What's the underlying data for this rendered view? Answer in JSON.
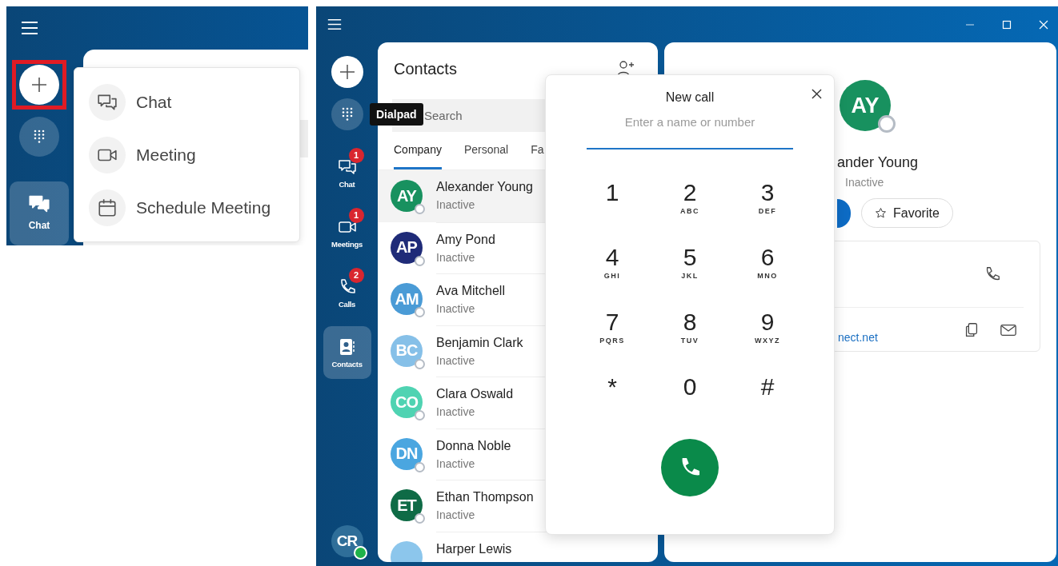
{
  "left_shot": {
    "plus_button": {
      "highlighted": true
    },
    "nav_items": [
      {
        "kind": "chat",
        "label": "Chat",
        "selected": true
      }
    ],
    "new_menu": [
      {
        "kind": "chat",
        "label": "Chat"
      },
      {
        "kind": "meeting",
        "label": "Meeting"
      },
      {
        "kind": "schedule",
        "label": "Schedule Meeting"
      }
    ]
  },
  "right_shot": {
    "rail": {
      "tooltip": "Dialpad",
      "nav_items": [
        {
          "kind": "chat",
          "label": "Chat",
          "badge": "1",
          "selected": false
        },
        {
          "kind": "meetings",
          "label": "Meetings",
          "badge": "1",
          "selected": false
        },
        {
          "kind": "calls",
          "label": "Calls",
          "badge": "2",
          "selected": false
        },
        {
          "kind": "contacts",
          "label": "Contacts",
          "selected": true
        }
      ],
      "user_avatar": {
        "initials": "CR",
        "online": true
      }
    },
    "contacts": {
      "title": "Contacts",
      "search": {
        "placeholder": "Search"
      },
      "tabs": [
        {
          "label": "Company",
          "selected": true
        },
        {
          "label": "Personal",
          "selected": false
        },
        {
          "label": "Fa",
          "selected": false
        }
      ],
      "list": [
        {
          "initials": "AY",
          "name": "Alexander Young",
          "status": "Inactive",
          "color": "#18915f",
          "selected": true
        },
        {
          "initials": "AP",
          "name": "Amy Pond",
          "status": "Inactive",
          "color": "#1f2b78",
          "selected": false
        },
        {
          "initials": "AM",
          "name": "Ava Mitchell",
          "status": "Inactive",
          "color": "#4a9bd6",
          "selected": false
        },
        {
          "initials": "BC",
          "name": "Benjamin Clark",
          "status": "Inactive",
          "color": "#86c0e8",
          "selected": false
        },
        {
          "initials": "CO",
          "name": "Clara Oswald",
          "status": "Inactive",
          "color": "#4fd3b2",
          "selected": false
        },
        {
          "initials": "DN",
          "name": "Donna Noble",
          "status": "Inactive",
          "color": "#4aa6e0",
          "selected": false
        },
        {
          "initials": "ET",
          "name": "Ethan Thompson",
          "status": "Inactive",
          "color": "#0f6b46",
          "selected": false
        },
        {
          "name": "Harper Lewis",
          "color": "#8cc6ec",
          "selected": false
        }
      ]
    },
    "detail": {
      "initials": "AY",
      "name": "ander Young",
      "status": "Inactive",
      "favorite_button": "Favorite",
      "email_link": "nect.net"
    },
    "new_call": {
      "title": "New call",
      "placeholder": "Enter a name or number",
      "keys": [
        {
          "digit": "1"
        },
        {
          "digit": "2",
          "letters": "ABC"
        },
        {
          "digit": "3",
          "letters": "DEF"
        },
        {
          "digit": "4",
          "letters": "GHI"
        },
        {
          "digit": "5",
          "letters": "JKL"
        },
        {
          "digit": "6",
          "letters": "MNO"
        },
        {
          "digit": "7",
          "letters": "PQRS"
        },
        {
          "digit": "8",
          "letters": "TUV"
        },
        {
          "digit": "9",
          "letters": "WXYZ"
        },
        {
          "digit": "*"
        },
        {
          "digit": "0"
        },
        {
          "digit": "#"
        }
      ]
    }
  }
}
